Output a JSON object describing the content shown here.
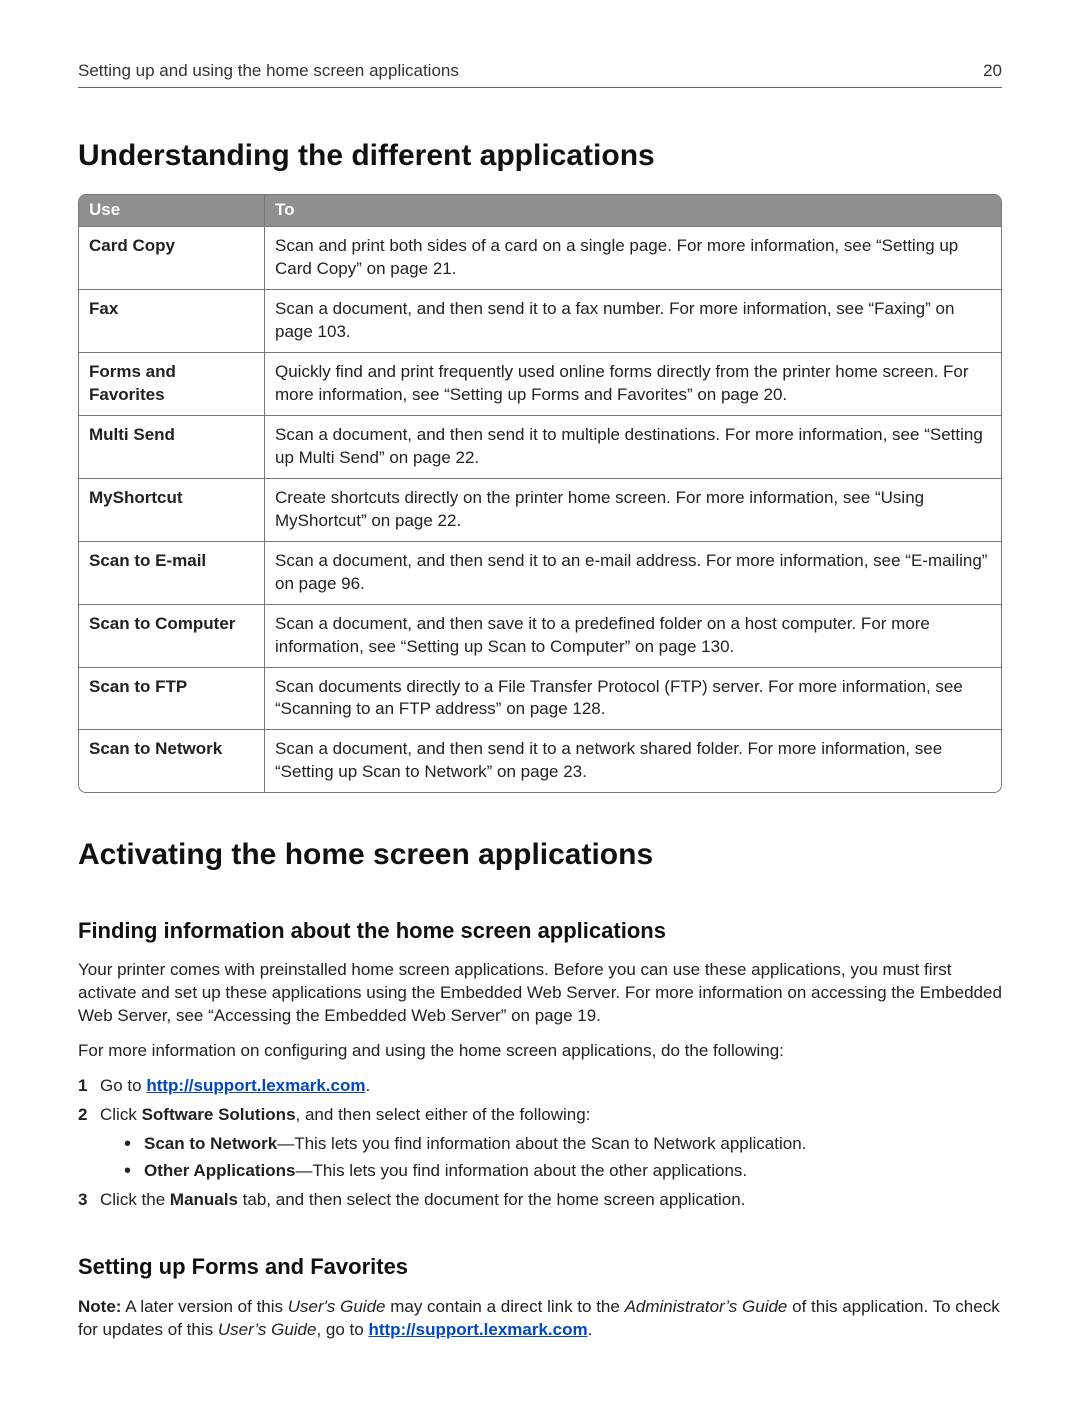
{
  "header": {
    "title": "Setting up and using the home screen applications",
    "page_number": "20"
  },
  "section1": {
    "heading": "Understanding the different applications",
    "table": {
      "head_use": "Use",
      "head_to": "To",
      "rows": [
        {
          "use": "Card Copy",
          "to": "Scan and print both sides of a card on a single page. For more information, see “Setting up Card Copy” on page 21."
        },
        {
          "use": "Fax",
          "to": "Scan a document, and then send it to a fax number. For more information, see “Faxing” on page 103."
        },
        {
          "use": "Forms and Favorites",
          "to": "Quickly find and print frequently used online forms directly from the printer home screen. For more information, see “Setting up Forms and Favorites” on page 20."
        },
        {
          "use": "Multi Send",
          "to": "Scan a document, and then send it to multiple destinations. For more information, see “Setting up Multi Send” on page 22."
        },
        {
          "use": "MyShortcut",
          "to": "Create shortcuts directly on the printer home screen. For more information, see “Using MyShortcut” on page 22."
        },
        {
          "use": "Scan to E-mail",
          "to": "Scan a document, and then send it to an e-mail address. For more information, see “E-mailing” on page 96."
        },
        {
          "use": "Scan to Computer",
          "to": "Scan a document, and then save it to a predefined folder on a host computer. For more information, see “Setting up Scan to Computer” on page 130."
        },
        {
          "use": "Scan to FTP",
          "to": "Scan documents directly to a File Transfer Protocol (FTP) server. For more information, see “Scanning to an FTP address” on page 128."
        },
        {
          "use": "Scan to Network",
          "to": "Scan a document, and then send it to a network shared folder. For more information, see “Setting up Scan to Network” on page 23."
        }
      ]
    }
  },
  "section2": {
    "heading": "Activating the home screen applications",
    "sub1": {
      "heading": "Finding information about the home screen applications",
      "para1": "Your printer comes with preinstalled home screen applications. Before you can use these applications, you must first activate and set up these applications using the Embedded Web Server. For more information on accessing the Embedded Web Server, see “Accessing the Embedded Web Server” on page 19.",
      "para2": "For more information on configuring and using the home screen applications, do the following:",
      "steps": {
        "n1": "1",
        "s1_prefix": "Go to ",
        "s1_link": "http://support.lexmark.com",
        "s1_suffix": ".",
        "n2": "2",
        "s2_prefix": "Click ",
        "s2_bold": "Software Solutions",
        "s2_suffix": ", and then select either of the following:",
        "b1_bold": "Scan to Network",
        "b1_rest": "—This lets you find information about the Scan to Network application.",
        "b2_bold": "Other Applications",
        "b2_rest": "—This lets you find information about the other applications.",
        "n3": "3",
        "s3_prefix": "Click the ",
        "s3_bold": "Manuals",
        "s3_suffix": " tab, and then select the document for the home screen application."
      }
    },
    "sub2": {
      "heading": "Setting up Forms and Favorites",
      "note_label": "Note:",
      "note_p1": " A later version of this ",
      "note_i1": "User's Guide",
      "note_p2": " may contain a direct link to the ",
      "note_i2": "Administrator’s Guide",
      "note_p3": " of this application. To check for updates of this ",
      "note_i3": "User’s Guide",
      "note_p4": ", go to ",
      "note_link": "http://support.lexmark.com",
      "note_p5": "."
    }
  }
}
